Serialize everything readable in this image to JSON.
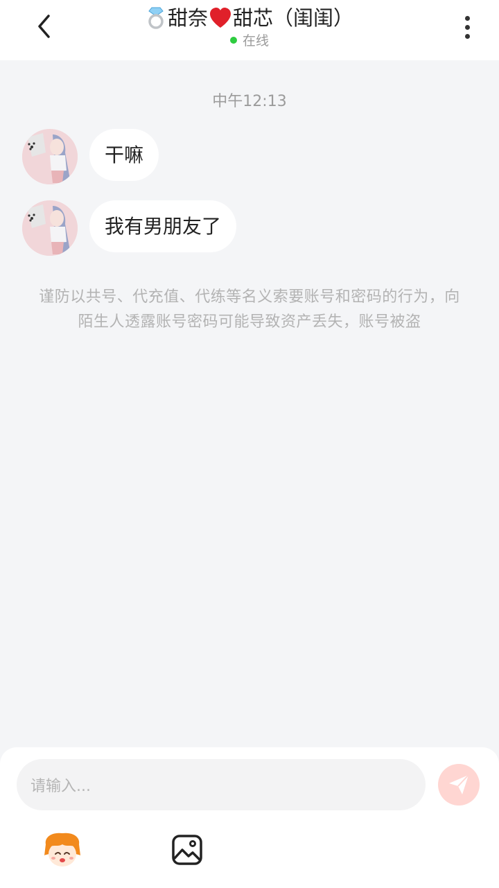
{
  "header": {
    "name_part1": "甜奈",
    "name_part2": "甜芯（闺闺）",
    "status": "在线",
    "status_color": "#2ecc40"
  },
  "chat": {
    "timestamp": "中午12:13",
    "messages": [
      {
        "text": "干嘛"
      },
      {
        "text": "我有男朋友了"
      }
    ],
    "warning": "谨防以共号、代充值、代练等名义索要账号和密码的行为，向陌生人透露账号密码可能导致资产丢失，账号被盗"
  },
  "composer": {
    "placeholder": "请输入..."
  },
  "icons": {
    "back": "chevron-left-icon",
    "more": "more-vertical-icon",
    "send": "send-icon",
    "mascot": "mascot-emoji-icon",
    "image": "image-icon"
  }
}
